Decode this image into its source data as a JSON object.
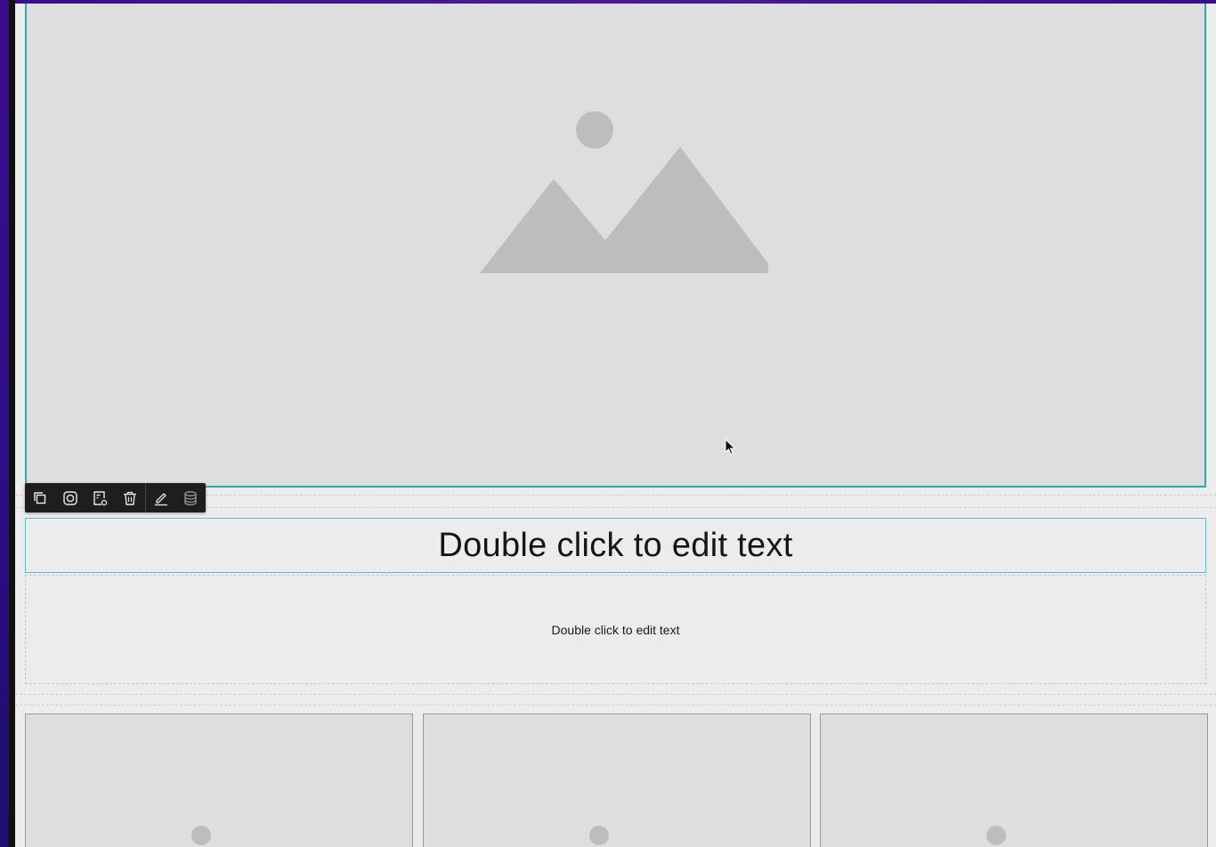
{
  "editor": {
    "toolbar": {
      "buttons": [
        {
          "name": "duplicate",
          "icon": "duplicate-icon"
        },
        {
          "name": "instagram",
          "icon": "instagram-icon"
        },
        {
          "name": "settings",
          "icon": "settings-icon"
        },
        {
          "name": "delete",
          "icon": "trash-icon"
        },
        {
          "name": "edit",
          "icon": "pencil-icon"
        },
        {
          "name": "data",
          "icon": "database-icon"
        }
      ]
    },
    "hero_image": {
      "icon": "image-placeholder-icon"
    },
    "heading": {
      "text": "Double click to edit text"
    },
    "body": {
      "text": "Double click to edit text"
    },
    "cards": [
      {
        "icon": "image-placeholder-icon"
      },
      {
        "icon": "image-placeholder-icon"
      },
      {
        "icon": "image-placeholder-icon"
      }
    ]
  },
  "colors": {
    "selection": "#35a6b4",
    "placeholder_bg": "#dedede",
    "placeholder_shape": "#bdbdbd",
    "canvas_bg": "#ececec",
    "accent_purple": "#3a0d8f",
    "toolbar_bg": "#1e1e1e"
  }
}
